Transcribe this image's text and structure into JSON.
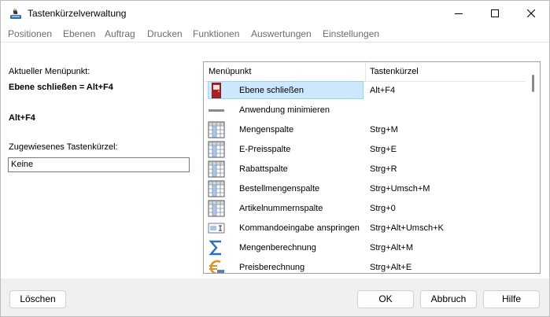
{
  "window": {
    "title": "Tastenkürzelverwaltung"
  },
  "menu": [
    "Positionen",
    "Ebenen",
    "Auftrag",
    "Drucken",
    "Funktionen",
    "Auswertungen",
    "Einstellungen"
  ],
  "left": {
    "current_label": "Aktueller Menüpunkt:",
    "current_value": "Ebene schließen = Alt+F4",
    "shortcut": "Alt+F4",
    "assigned_label": "Zugewiesenes Tastenkürzel:",
    "assigned_value": "Keine"
  },
  "list": {
    "headers": [
      "Menüpunkt",
      "Tastenkürzel"
    ],
    "rows": [
      {
        "name": "Ebene schließen",
        "key": "Alt+F4",
        "icon": "door-icon",
        "selected": true
      },
      {
        "name": "Anwendung minimieren",
        "key": "",
        "icon": "minimize-icon"
      },
      {
        "name": "Mengenspalte",
        "key": "Strg+M",
        "icon": "grid-icon"
      },
      {
        "name": "E-Preisspalte",
        "key": "Strg+E",
        "icon": "grid-icon"
      },
      {
        "name": "Rabattspalte",
        "key": "Strg+R",
        "icon": "grid-icon"
      },
      {
        "name": "Bestellmengenspalte",
        "key": "Strg+Umsch+M",
        "icon": "grid-icon"
      },
      {
        "name": "Artikelnummernspalte",
        "key": "Strg+0",
        "icon": "grid-icon"
      },
      {
        "name": "Kommandoeingabe anspringen",
        "key": "Strg+Alt+Umsch+K",
        "icon": "command-input-icon"
      },
      {
        "name": "Mengenberechnung",
        "key": "Strg+Alt+M",
        "icon": "sigma-icon"
      },
      {
        "name": "Preisberechnung",
        "key": "Strg+Alt+E",
        "icon": "euro-icon"
      }
    ]
  },
  "buttons": {
    "delete": "Löschen",
    "ok": "OK",
    "cancel": "Abbruch",
    "help": "Hilfe"
  },
  "colors": {
    "selection": "#cce8ff",
    "selection_border": "#99d1ff",
    "menu_text": "#6d6d6d",
    "door": "#8b1a1a",
    "sigma": "#2c6fb5",
    "euro": "#e0922a"
  }
}
